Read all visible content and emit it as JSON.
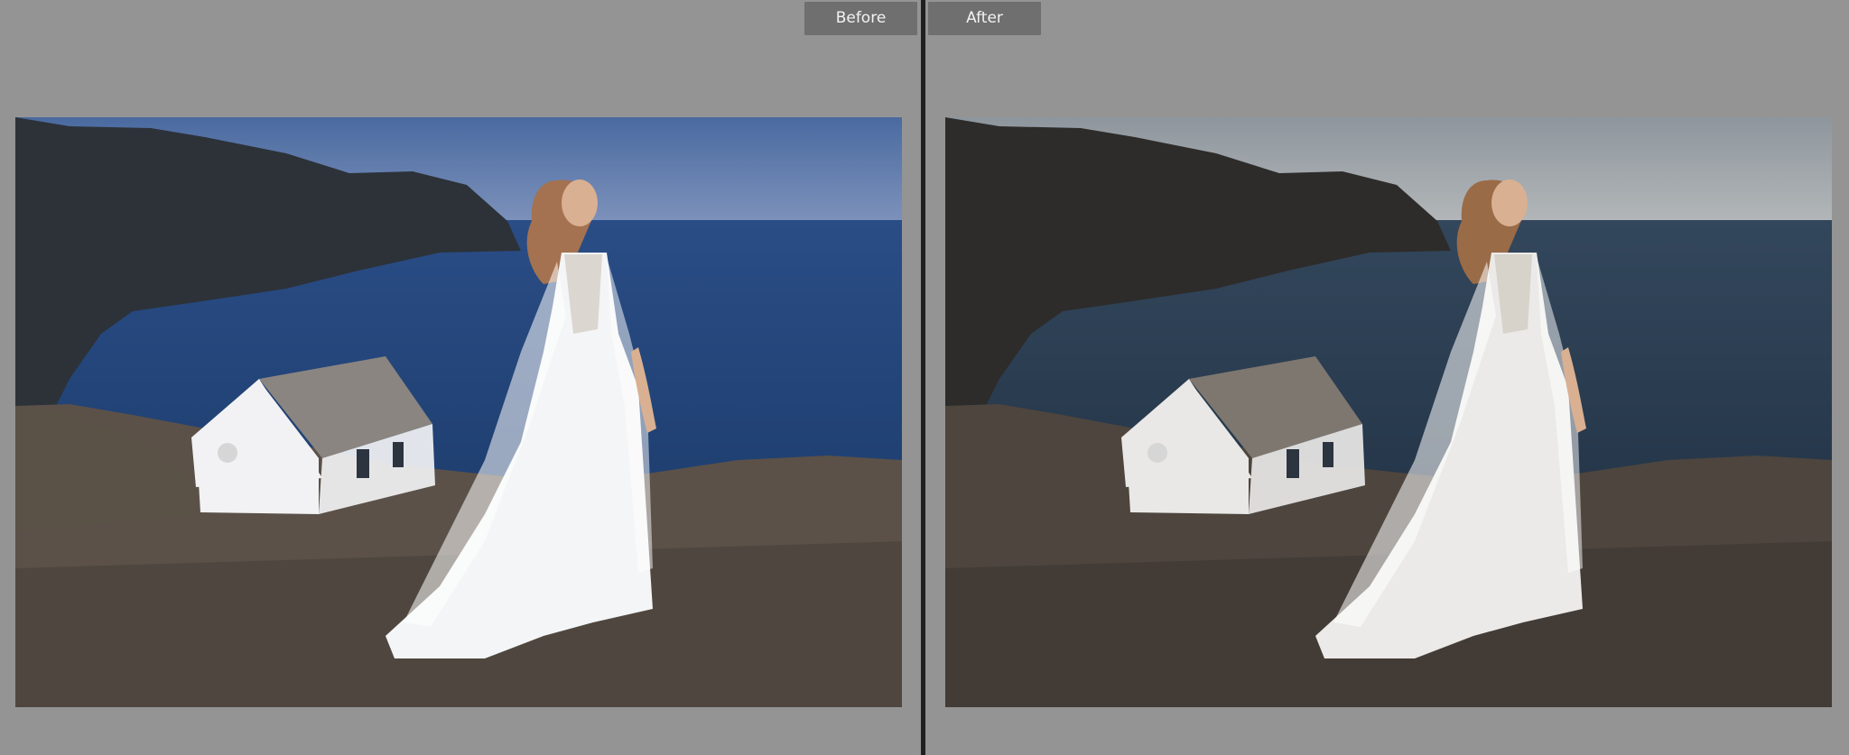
{
  "compare_view": {
    "before_label": "Before",
    "after_label": "After",
    "before_photo": {
      "icon": "before-photo-thumbnail",
      "colors": {
        "sky_top": "#4a6aa0",
        "sky_bottom": "#7d92bb",
        "sea": "#1f3f70",
        "sea_far": "#2a4d86",
        "cliff": "#2c3238",
        "ground": "#5b5148",
        "house": "#f2f2f4",
        "roof": "#8a8580",
        "dress": "#f4f5f7",
        "hair": "#a47250"
      }
    },
    "after_photo": {
      "icon": "after-photo-thumbnail",
      "colors": {
        "sky_top": "#8e969d",
        "sky_bottom": "#b3b7b9",
        "sea": "#253649",
        "sea_far": "#33475c",
        "cliff": "#2d2c2a",
        "ground": "#4d453e",
        "house": "#e9e8e6",
        "roof": "#7e7770",
        "dress": "#ebeae8",
        "hair": "#9a6b47"
      }
    }
  }
}
